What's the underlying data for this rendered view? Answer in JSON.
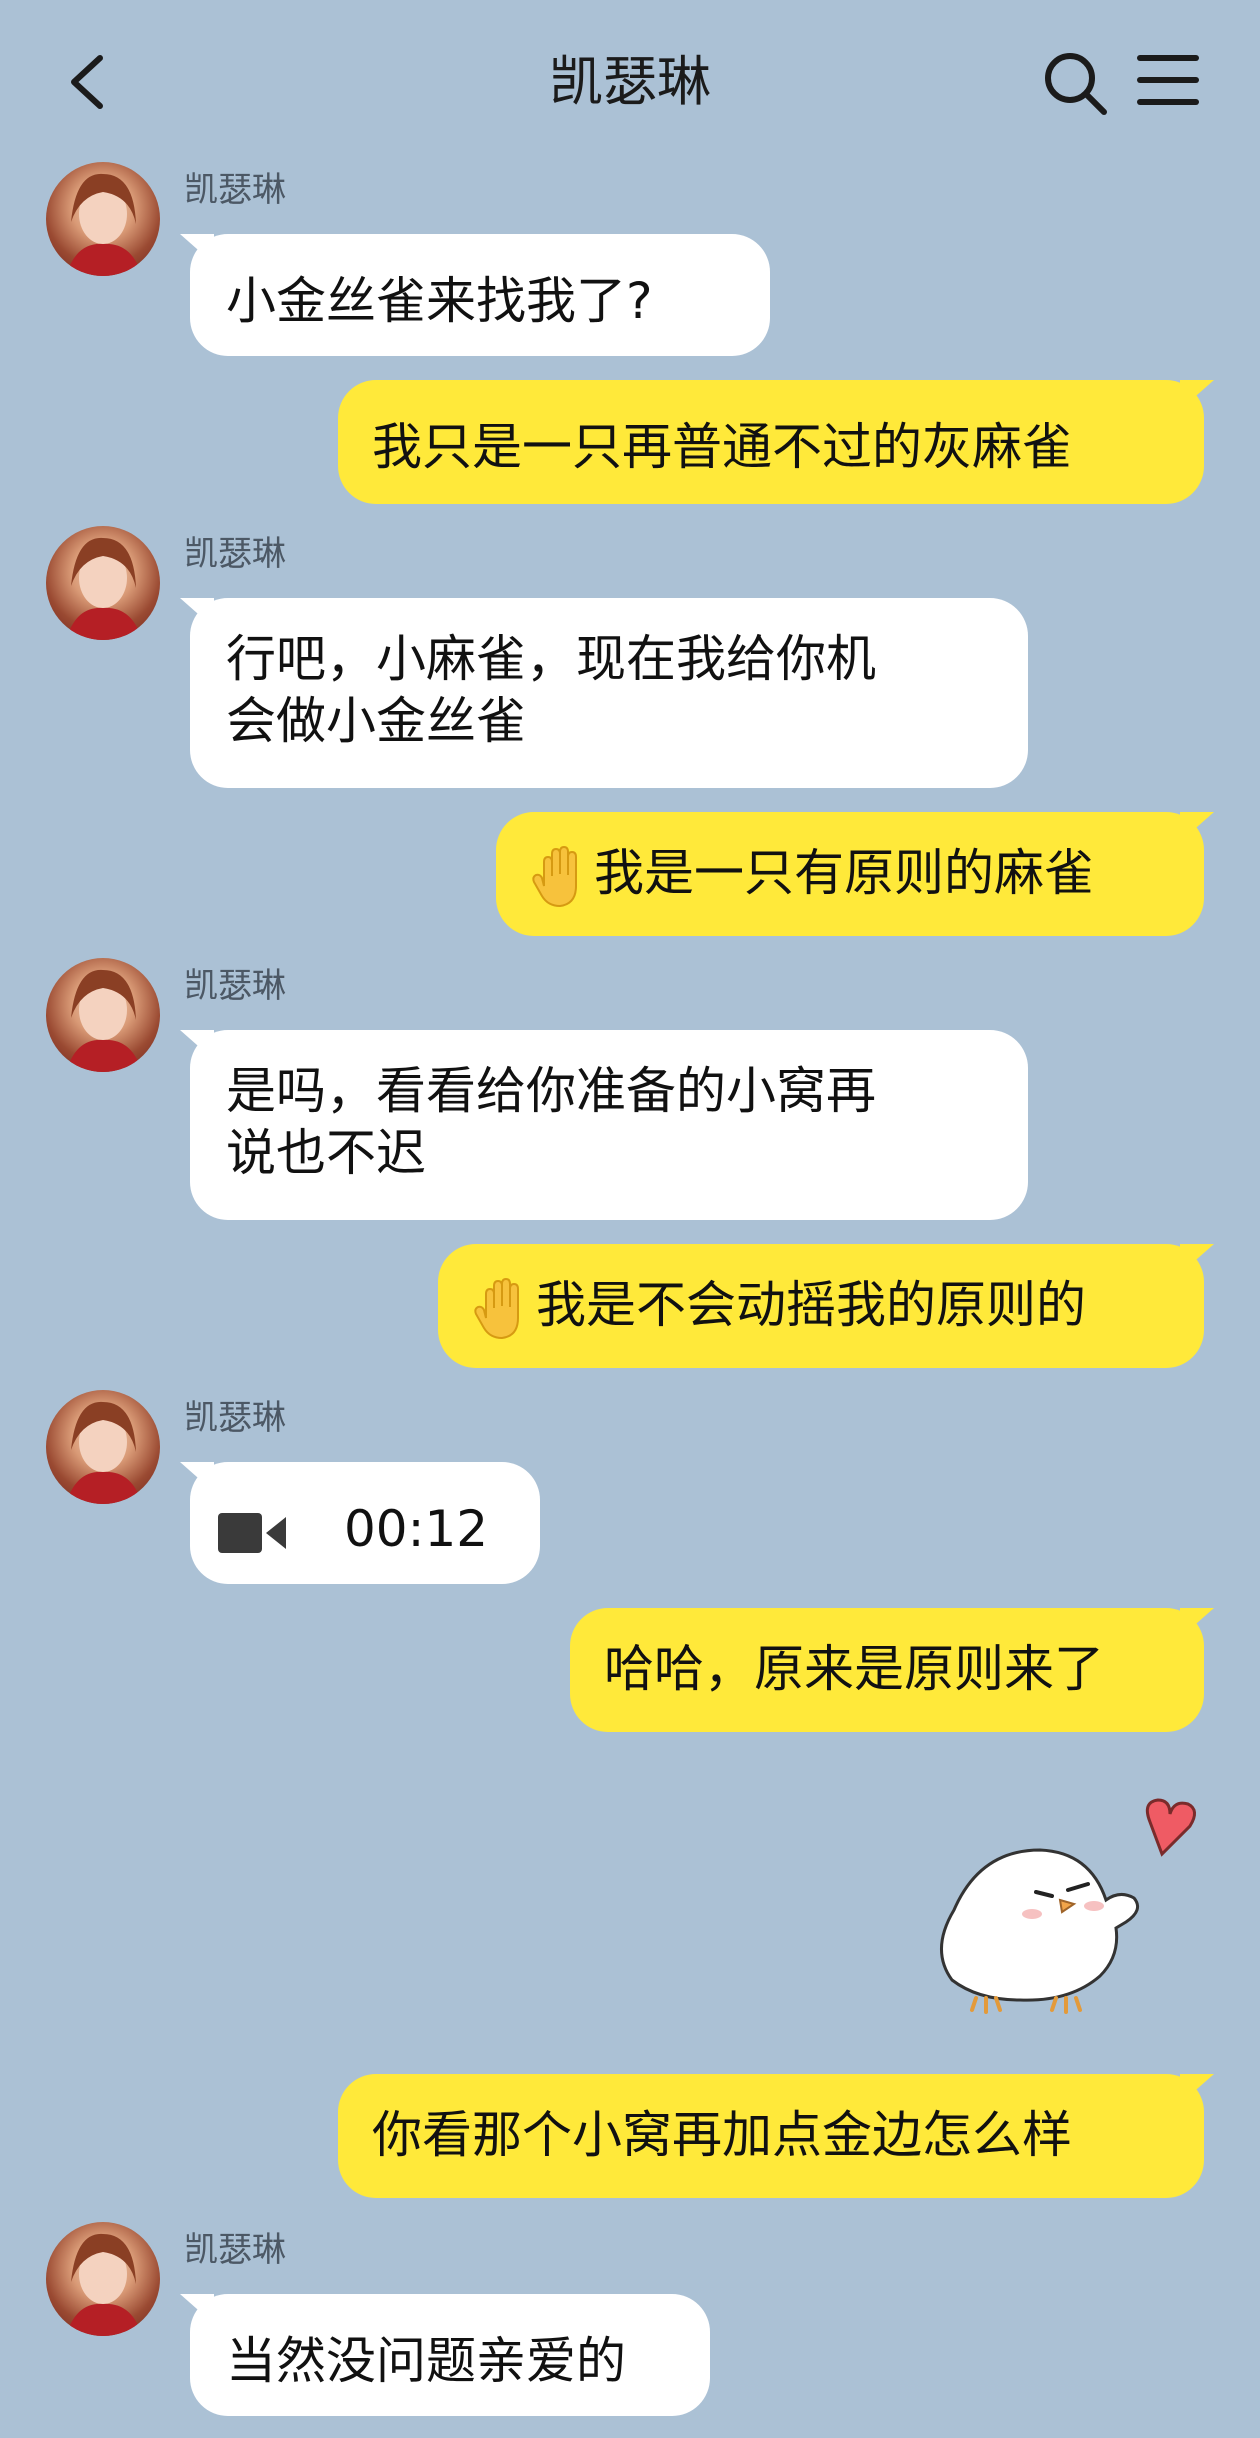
{
  "header": {
    "title": "凯瑟琳",
    "back_icon": "chevron-left-icon",
    "search_icon": "search-icon",
    "menu_icon": "menu-icon"
  },
  "contact": {
    "name": "凯瑟琳"
  },
  "messages": [
    {
      "from": "contact",
      "text": "小金丝雀来找我了?"
    },
    {
      "from": "me",
      "text": "我只是一只再普通不过的灰麻雀"
    },
    {
      "from": "contact",
      "text": "行吧，小麻雀，现在我给你机\n会做小金丝雀"
    },
    {
      "from": "me",
      "emoji": "raised-hand-icon",
      "text": "我是一只有原则的麻雀"
    },
    {
      "from": "contact",
      "text": "是吗，看看给你准备的小窝再\n说也不迟"
    },
    {
      "from": "me",
      "emoji": "raised-hand-icon",
      "text": "我是不会动摇我的原则的"
    },
    {
      "from": "contact",
      "type": "video-call",
      "icon": "video-camera-icon",
      "duration": "00:12"
    },
    {
      "from": "me",
      "text": "哈哈，原来是原则来了"
    },
    {
      "from": "me",
      "type": "sticker",
      "sticker": "white-chick-heart-sticker"
    },
    {
      "from": "me",
      "text": "你看那个小窝再加点金边怎么样"
    },
    {
      "from": "contact",
      "text": "当然没问题亲爱的"
    }
  ],
  "colors": {
    "background": "#abc1d5",
    "outgoing_bubble": "#ffe93a",
    "incoming_bubble": "#ffffff"
  }
}
